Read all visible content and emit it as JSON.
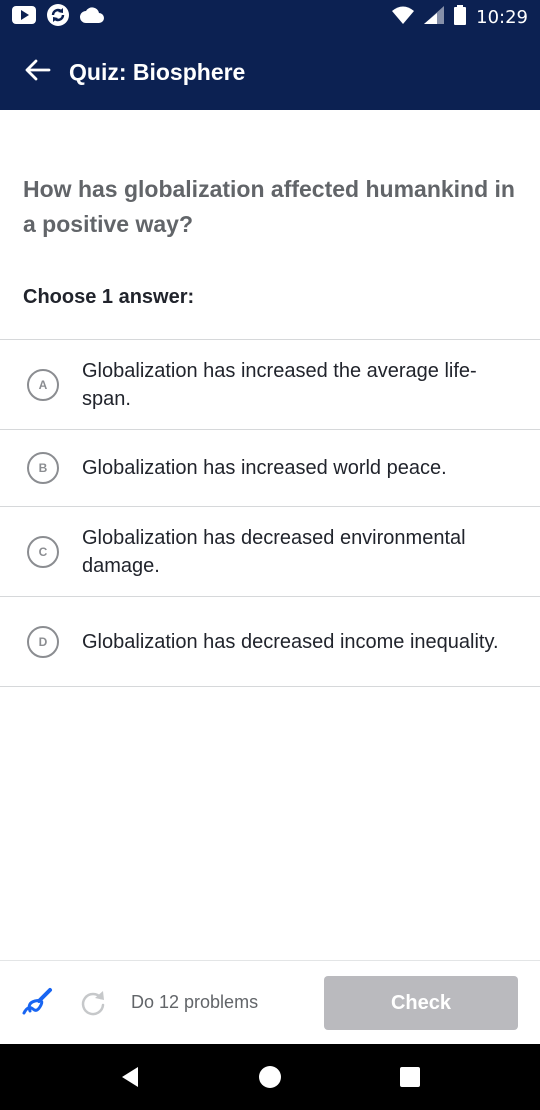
{
  "status_bar": {
    "time": "10:29",
    "left_icons": [
      "youtube-icon",
      "sync-icon",
      "cloud-icon"
    ],
    "right_icons": [
      "wifi-icon",
      "signal-icon",
      "battery-icon"
    ]
  },
  "app_bar": {
    "title": "Quiz: Biosphere",
    "background": "#0c2152"
  },
  "question": {
    "text": "How has globalization affected humankind in a positive way?",
    "prompt": "Choose 1 answer:"
  },
  "choices": [
    {
      "letter": "A",
      "text": "Globalization has increased the average life-span."
    },
    {
      "letter": "B",
      "text": "Globalization has increased world peace."
    },
    {
      "letter": "C",
      "text": "Globalization has decreased environmental damage."
    },
    {
      "letter": "D",
      "text": "Globalization has decreased income inequality."
    }
  ],
  "footer": {
    "problems_label": "Do 12 problems",
    "check_label": "Check",
    "check_color": "#bababe",
    "scratchpad_color": "#1865f2"
  },
  "nav_bar": {
    "icons": [
      "back-icon",
      "home-icon",
      "recents-icon"
    ]
  }
}
